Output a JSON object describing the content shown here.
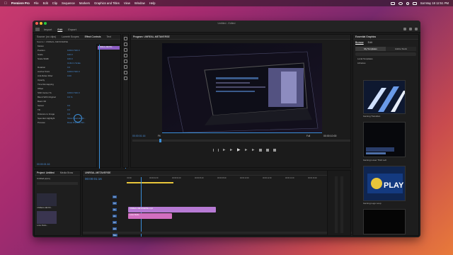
{
  "menubar": {
    "app": "Premiere Pro",
    "items": [
      "File",
      "Edit",
      "Clip",
      "Sequence",
      "Markers",
      "Graphics and Titles",
      "View",
      "Window",
      "Help"
    ],
    "datetime": "Sat May 18  12:51 PM"
  },
  "window": {
    "title": "Untitled - Edited",
    "tabs": [
      "Import",
      "Edit",
      "Export"
    ],
    "active_tab": "Edit"
  },
  "source_panel": {
    "tabs": [
      "Source: (no clips)",
      "Lumetri Scopes",
      "Effect Controls",
      "Text"
    ],
    "master": "Source > UNREAL-METAVERSE",
    "sequence": "UNREAL-METAV...",
    "rows": [
      {
        "label": "Motion",
        "val": ""
      },
      {
        "label": "Position",
        "val": "1000.0  540.0"
      },
      {
        "label": "Scale",
        "val": "100.0"
      },
      {
        "label": "Scale Width",
        "val": "100.0"
      },
      {
        "label": "",
        "val": "Uniform Scale"
      },
      {
        "label": "Rotation",
        "val": "0.0"
      },
      {
        "label": "Anchor Point",
        "val": "1000.0  540.0"
      },
      {
        "label": "Anti-flicker Filter",
        "val": "0.00"
      },
      {
        "label": "Opacity",
        "val": ""
      },
      {
        "label": "Time Remapping",
        "val": ""
      },
      {
        "label": "Offset",
        "val": ""
      },
      {
        "label": "Shift Center To",
        "val": "1000.0  540.0"
      },
      {
        "label": "Blend With Original",
        "val": "0.0 %"
      },
      {
        "label": "Basic 3D",
        "val": ""
      },
      {
        "label": "Swivel",
        "val": "0.0"
      },
      {
        "label": "Tilt",
        "val": "0.0"
      },
      {
        "label": "Distance to Image",
        "val": "0.0"
      },
      {
        "label": "Specular Highlight",
        "val": "Show Specular Hi..."
      },
      {
        "label": "Preview",
        "val": "Draw Preview Wir..."
      }
    ],
    "timecode": "00:00:01:16"
  },
  "program_monitor": {
    "title": "Program: UNREAL-METAVERSE",
    "timecode_left": "00:00:01:16",
    "fit": "Fit",
    "quality": "Full",
    "timecode_right": "00:00:10:00"
  },
  "project_panel": {
    "tabs": [
      "Project: Untitled",
      "Media Brow"
    ],
    "file": "Untitled.prproj",
    "items": [
      {
        "name": "UNREAL-METAV..."
      },
      {
        "name": "Lotus Mode..."
      }
    ]
  },
  "timeline": {
    "tab": "UNREAL-METAVERSE",
    "timecode": "00:00:01:16",
    "ruler": [
      ":00:00",
      "00:00:02:00",
      "00:00:04:00",
      "00:00:06:00",
      "00:00:08:00",
      "00:00:10:00",
      "00:00:12:00",
      "00:00:14:00",
      "00:00:16:00",
      "00:00:18:00"
    ],
    "tracks": [
      "V3",
      "V2",
      "V1",
      "A1",
      "A2",
      "A3",
      "Mix"
    ],
    "clips": [
      {
        "name": "UNREAL-METAVERSE.mp4",
        "color": "#b77ad4"
      },
      {
        "name": "Lotus Mode",
        "color": "#d26fc0"
      }
    ]
  },
  "essential_graphics": {
    "title": "Essential Graphics",
    "tabs": [
      "Browse",
      "Edit"
    ],
    "source_tabs": [
      "My Templates",
      "Adobe Stock"
    ],
    "filters": [
      "Local Templates",
      "Libraries"
    ],
    "templates": [
      {
        "name": "Gaming Transition"
      },
      {
        "name": "Gaming Lower Third Left"
      },
      {
        "name": "Gaming Logo Loop"
      },
      {
        "name": "PLAY"
      }
    ]
  }
}
